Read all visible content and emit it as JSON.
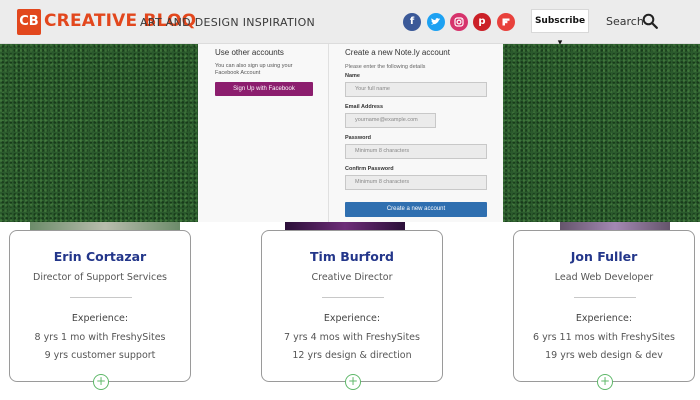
{
  "header": {
    "logo_mark": "CB",
    "logo_word": "CREATIVE BLOQ",
    "tagline": "ART AND DESIGN INSPIRATION",
    "subscribe_label": "Subscribe ▾",
    "search_label": "Search",
    "social_icons": [
      "facebook-icon",
      "twitter-icon",
      "instagram-icon",
      "pinterest-icon",
      "flipboard-icon"
    ],
    "brand_color": "#e2471d"
  },
  "popup": {
    "other_title": "Use other accounts",
    "other_desc": "You can also sign up using your Facebook Account",
    "facebook_button": "Sign Up with Facebook",
    "create_title": "Create a new Note.ly account",
    "create_sub": "Please enter the following details",
    "fields": [
      {
        "label": "Name",
        "placeholder": "Your full name"
      },
      {
        "label": "Email Address",
        "placeholder": "yourname@example.com"
      },
      {
        "label": "Password",
        "placeholder": "Minimum 8 characters"
      },
      {
        "label": "Confirm Password",
        "placeholder": "Minimum 8 characters"
      }
    ],
    "create_button": "Create a new account"
  },
  "cards": [
    {
      "name": "Erin Cortazar",
      "role": "Director of Support Services",
      "experience_label": "Experience:",
      "line1": "8 yrs 1 mo with FreshySites",
      "line2": "9 yrs customer support"
    },
    {
      "name": "Tim Burford",
      "role": "Creative Director",
      "experience_label": "Experience:",
      "line1": "7 yrs 4 mos with FreshySites",
      "line2": "12 yrs design & direction"
    },
    {
      "name": "Jon Fuller",
      "role": "Lead Web Developer",
      "experience_label": "Experience:",
      "line1": "6 yrs 11 mos with FreshySites",
      "line2": "19 yrs web design & dev"
    }
  ],
  "colors": {
    "name_color": "#23368a",
    "plus_color": "#5fb86a",
    "create_button_color": "#2f6fb0",
    "facebook_button_color": "#8c1e6e"
  }
}
